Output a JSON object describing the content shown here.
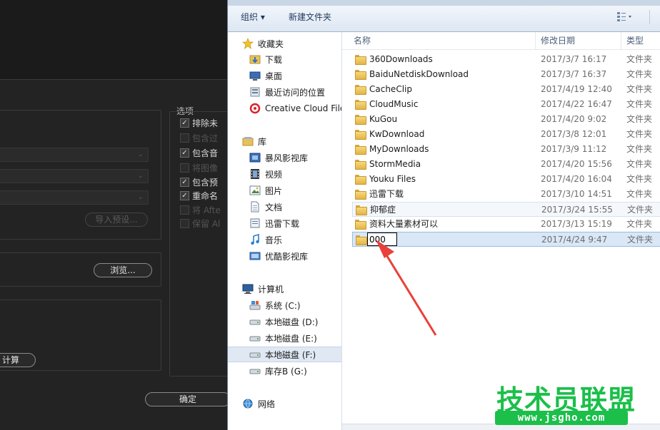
{
  "bg_dialog": {
    "options_title": "选项",
    "checkboxes": [
      {
        "label": "排除未",
        "checked": true
      },
      {
        "label": "包含过",
        "checked": false
      },
      {
        "label": "包含音",
        "checked": true
      },
      {
        "label": "将图像",
        "checked": false
      },
      {
        "label": "包含预",
        "checked": true
      },
      {
        "label": "重命名",
        "checked": true
      },
      {
        "label": "将 Afte",
        "checked": false
      },
      {
        "label": "保留 Al",
        "checked": false
      }
    ],
    "import_preset_label": "导入预设...",
    "browse_label": "浏览...",
    "calc_label": "计算",
    "ok_label": "确定"
  },
  "toolbar": {
    "organize": "组织 ▾",
    "new_folder": "新建文件夹",
    "view_icon": "view-options-icon"
  },
  "nav": {
    "favorites": "收藏夹",
    "downloads": "下载",
    "desktop": "桌面",
    "recent": "最近访问的位置",
    "creative_cloud": "Creative Cloud Files",
    "libraries": "库",
    "storm": "暴风影视库",
    "videos": "视频",
    "pictures": "图片",
    "documents": "文档",
    "xunlei": "迅雷下载",
    "music": "音乐",
    "youku": "优酷影视库",
    "computer": "计算机",
    "drive_c": "系统 (C:)",
    "drive_d": "本地磁盘 (D:)",
    "drive_e": "本地磁盘 (E:)",
    "drive_f": "本地磁盘 (F:)",
    "drive_g": "库存B (G:)",
    "network": "网络"
  },
  "columns": {
    "name": "名称",
    "date": "修改日期",
    "type": "类型"
  },
  "files": [
    {
      "name": "360Downloads",
      "date": "2017/3/7 16:17",
      "type": "文件夹"
    },
    {
      "name": "BaiduNetdiskDownload",
      "date": "2017/3/7 16:37",
      "type": "文件夹"
    },
    {
      "name": "CacheClip",
      "date": "2017/4/19 12:40",
      "type": "文件夹"
    },
    {
      "name": "CloudMusic",
      "date": "2017/4/22 16:47",
      "type": "文件夹"
    },
    {
      "name": "KuGou",
      "date": "2017/4/20 9:02",
      "type": "文件夹"
    },
    {
      "name": "KwDownload",
      "date": "2017/3/8 12:01",
      "type": "文件夹"
    },
    {
      "name": "MyDownloads",
      "date": "2017/3/9 11:12",
      "type": "文件夹"
    },
    {
      "name": "StormMedia",
      "date": "2017/4/20 15:56",
      "type": "文件夹"
    },
    {
      "name": "Youku Files",
      "date": "2017/4/20 16:04",
      "type": "文件夹"
    },
    {
      "name": "迅雷下载",
      "date": "2017/3/10 14:51",
      "type": "文件夹"
    },
    {
      "name": "抑郁症",
      "date": "2017/3/24 15:55",
      "type": "文件夹"
    },
    {
      "name": "资料大量素材可以",
      "date": "2017/3/13 15:19",
      "type": "文件夹"
    },
    {
      "name": "000",
      "date": "2017/4/24 9:47",
      "type": "文件夹"
    }
  ],
  "watermark": {
    "title": "技术员联盟",
    "url": "www.jsgho.com"
  },
  "colors": {
    "annotation_arrow": "#e8413a",
    "watermark_green": "#1bbf4a",
    "selection": "#d9e7f6"
  }
}
